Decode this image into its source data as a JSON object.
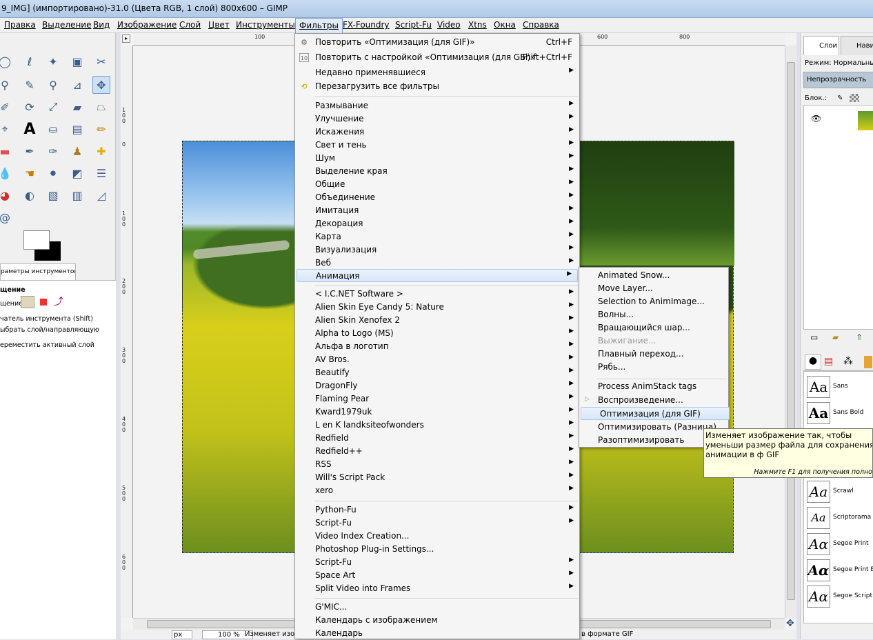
{
  "window": {
    "title": "9_IMG] (импортировано)-31.0 (Цвета RGB, 1 слой) 800x600 – GIMP"
  },
  "menubar": [
    "Правка",
    "Выделение",
    "Вид",
    "Изображение",
    "Слой",
    "Цвет",
    "Инструменты",
    "Фильтры",
    "FX-Foundry",
    "Script-Fu",
    "Video",
    "Xtns",
    "Окна",
    "Справка"
  ],
  "toolbox": {
    "options_tab": "раметры инструментов",
    "options_heading": "щение",
    "mode_label": "щение:",
    "opt1": "чатель инструмента  (Shift)",
    "opt2": "ыбрать слой/направляющую",
    "opt3": "ереместить активный слой"
  },
  "rulers": {
    "h_ticks": [
      "100",
      "600",
      "800"
    ],
    "v_ticks": [
      "1\n0\n0",
      "0",
      "1\n0\n0",
      "2\n0\n0",
      "3\n0\n0",
      "4\n0\n0",
      "5\n0\n0",
      "6\n0\n0"
    ]
  },
  "statusbar": {
    "unit": "px",
    "zoom": "100 %",
    "text_left": "Изменяет изо",
    "text_right": "в формате GIF"
  },
  "filters_menu": {
    "repeat_label": "Повторить «Оптимизация (для GIF)»",
    "repeat_shortcut": "Ctrl+F",
    "reshow_label": "Повторить с настройкой «Оптимизация (для GIF)»",
    "reshow_shortcut": "Shift+Ctrl+F",
    "recent_label": "Недавно применявшиеся",
    "reset_label": "Перезагрузить все фильтры",
    "group1": [
      "Размывание",
      "Улучшение",
      "Искажения",
      "Свет и тень",
      "Шум",
      "Выделение края",
      "Общие",
      "Объединение",
      "Имитация",
      "Декорация",
      "Карта",
      "Визуализация",
      "Веб"
    ],
    "animation_label": "Анимация",
    "group2": [
      "< I.C.NET Software >",
      "Alien Skin Eye Candy 5: Nature",
      "Alien Skin Xenofex 2",
      "Alpha to Logo (MS)",
      "Альфа в логотип",
      "AV Bros.",
      "Beautify",
      "DragonFly",
      "Flaming Pear",
      "Kward1979uk",
      "L en K landksiteofwonders",
      "Redfield",
      "Redfield++",
      "RSS",
      "Will's Script Pack",
      "xero"
    ],
    "group3": [
      "Python-Fu",
      "Script-Fu",
      "Video Index Creation...",
      "Photoshop Plug-in Settings...",
      "Script-Fu",
      "Space Art",
      "Split Video into Frames"
    ],
    "group3_arrows": [
      true,
      true,
      false,
      false,
      true,
      true,
      true
    ],
    "group4": [
      "G'MIC...",
      "Календарь с изображением",
      "Календарь"
    ]
  },
  "animation_submenu": {
    "items": [
      "Animated Snow...",
      "Move Layer...",
      "Selection to AnimImage...",
      "Волны...",
      "Вращающийся шар...",
      "Выжигание...",
      "Плавный переход...",
      "Рябь..."
    ],
    "disabled_index": 5,
    "items2": [
      "Process AnimStack tags",
      "Воспроизведение...",
      "Оптимизация (для GIF)",
      "Оптимизировать (Разница)",
      "Разоптимизировать"
    ]
  },
  "tooltip": {
    "text": "Изменяет изображение так, чтобы уменьши размер файла для сохранения анимации в ф GIF",
    "hint": "Нажмите F1 для получения полно"
  },
  "layers_dock": {
    "tab_layers": "Слои",
    "tab_nav": "Нави",
    "mode_label": "Режим:",
    "mode_value": "Нормальный",
    "opacity_label": "Непрозрачность",
    "lock_label": "Блок.:"
  },
  "fonts_dock": {
    "fonts": [
      {
        "sample": "Aa",
        "name": "Sans"
      },
      {
        "sample": "Aa",
        "name": "Sans Bold"
      },
      {
        "sample": "Aa",
        "name": "Scrawl"
      },
      {
        "sample": "Aa",
        "name": "Scriptorama"
      },
      {
        "sample": "Aα",
        "name": "Segoe Print"
      },
      {
        "sample": "Aα",
        "name": "Segoe Print B"
      },
      {
        "sample": "Aα",
        "name": "Segoe Script"
      }
    ]
  },
  "colors": {
    "accent": "#d8e6f7",
    "menu_bg": "#f5f5f5",
    "tooltip_bg": "#ffffe1"
  }
}
